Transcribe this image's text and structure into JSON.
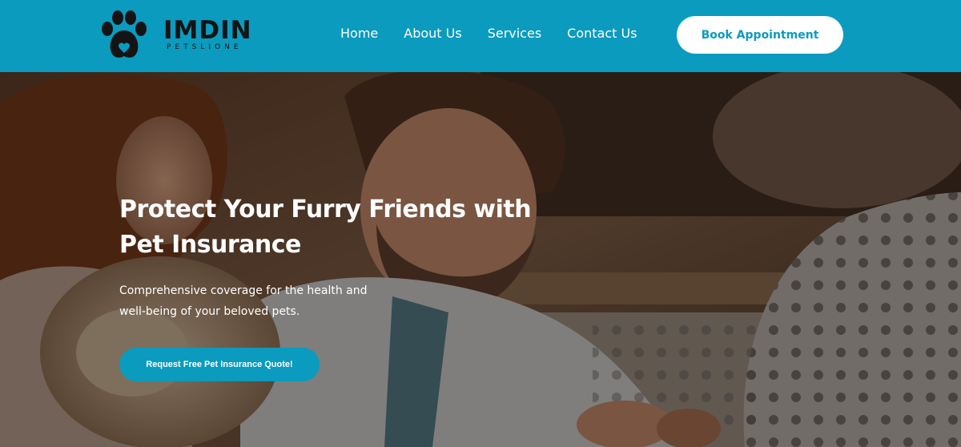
{
  "brand": {
    "name": "IMDIN",
    "tagline": "PETSLIONE",
    "logo_icon": "paw-heart-icon"
  },
  "nav": {
    "items": [
      {
        "label": "Home"
      },
      {
        "label": "About Us"
      },
      {
        "label": "Services"
      },
      {
        "label": "Contact Us"
      }
    ],
    "cta_label": "Book Appointment"
  },
  "hero": {
    "title": "Protect Your Furry Friends with Pet Insurance",
    "subtitle": "Comprehensive coverage for the health and well-being of your beloved pets.",
    "cta_label": "Request Free Pet Insurance Quote!"
  },
  "colors": {
    "accent": "#0a9bbf",
    "header_bg": "#0a9bbf",
    "button_text": "#0a9bbf",
    "hero_text": "#ffffff"
  }
}
